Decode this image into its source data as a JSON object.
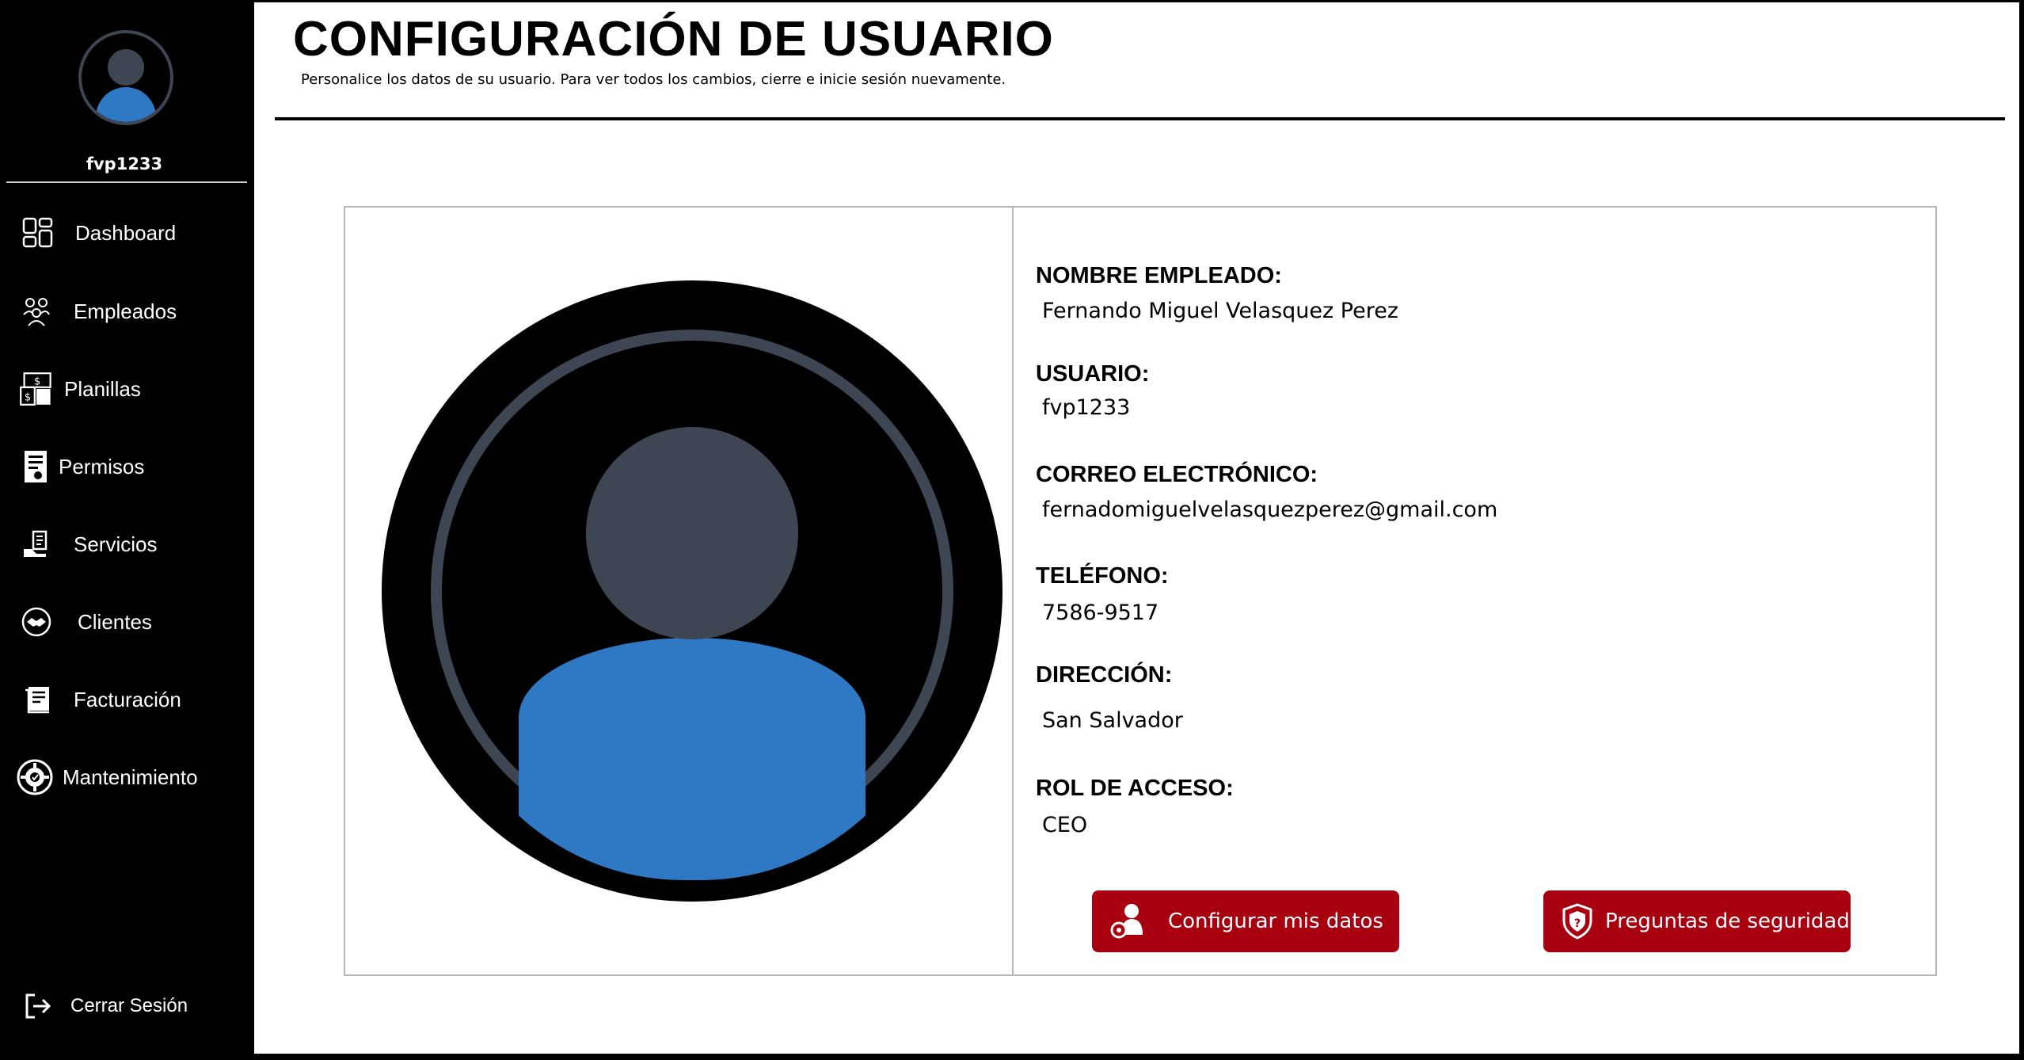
{
  "sidebar": {
    "username": "fvp1233",
    "items": [
      {
        "label": "Dashboard",
        "icon": "dashboard-icon"
      },
      {
        "label": "Empleados",
        "icon": "employees-icon"
      },
      {
        "label": "Planillas",
        "icon": "payroll-icon"
      },
      {
        "label": "Permisos",
        "icon": "permissions-icon"
      },
      {
        "label": "Servicios",
        "icon": "services-icon"
      },
      {
        "label": "Clientes",
        "icon": "clients-icon"
      },
      {
        "label": "Facturación",
        "icon": "invoice-icon"
      },
      {
        "label": "Mantenimiento",
        "icon": "maintenance-icon"
      }
    ],
    "logout": {
      "label": "Cerrar Sesión",
      "icon": "logout-icon"
    }
  },
  "header": {
    "title": "CONFIGURACIÓN DE USUARIO",
    "subtitle": "Personalice los datos de su usuario. Para ver todos los cambios, cierre e inicie sesión nuevamente."
  },
  "profile": {
    "fields": [
      {
        "label": "NOMBRE EMPLEADO:",
        "value": "Fernando Miguel Velasquez Perez"
      },
      {
        "label": "USUARIO:",
        "value": "fvp1233"
      },
      {
        "label": "CORREO ELECTRÓNICO:",
        "value": "fernadomiguelvelasquezperez@gmail.com"
      },
      {
        "label": "TELÉFONO:",
        "value": "7586-9517"
      },
      {
        "label": "DIRECCIÓN:",
        "value": "San Salvador"
      },
      {
        "label": "ROL DE ACCESO:",
        "value": "CEO"
      }
    ]
  },
  "actions": {
    "configure_label": "Configurar mis datos",
    "security_label": "Preguntas de seguridad"
  },
  "colors": {
    "sidebar_bg": "#000000",
    "avatar_body": "#2f78c4",
    "avatar_head": "#3d4652",
    "button_bg": "#a8000f"
  }
}
